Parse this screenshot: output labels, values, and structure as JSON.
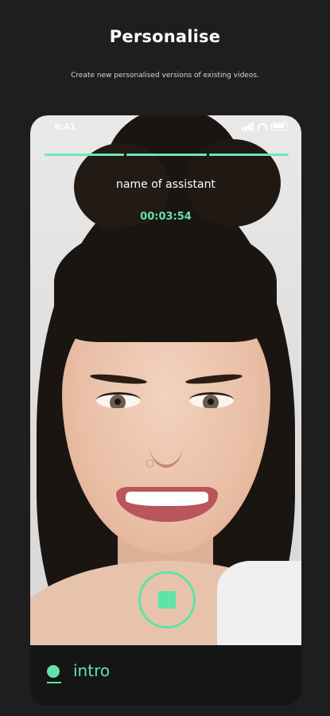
{
  "header": {
    "title": "Personalise",
    "subtitle": "Create new personalised versions of existing videos."
  },
  "device": {
    "status_time": "9:41"
  },
  "recording": {
    "assistant_name": "name of assistant",
    "elapsed": "00:03:54",
    "segments": 3,
    "stop_button_icon": "stop-square-icon"
  },
  "tabbar": {
    "active_label": "intro",
    "indicator_icon": "dot-icon"
  },
  "colors": {
    "accent": "#5ee3a8",
    "background": "#1e1e1e"
  }
}
